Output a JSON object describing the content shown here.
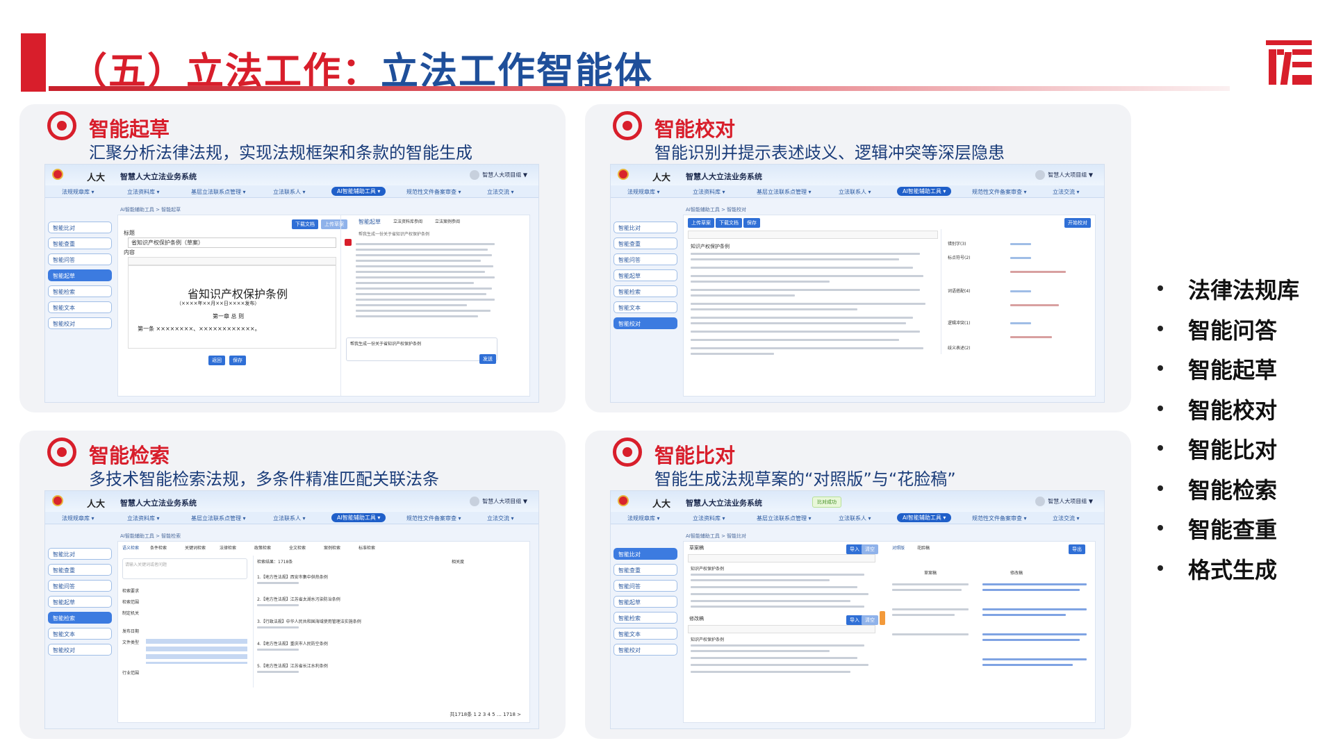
{
  "slide": {
    "title_part1": "（五）立法工作：",
    "title_part2": "立法工作智能体"
  },
  "feature_list": [
    "法律法规库",
    "智能问答",
    "智能起草",
    "智能校对",
    "智能比对",
    "智能检索",
    "智能查重",
    "格式生成"
  ],
  "panels": [
    {
      "title": "智能起草",
      "desc": "汇聚分析法律法规，实现法规框架和条款的智能生成"
    },
    {
      "title": "智能校对",
      "desc": "智能识别并提示表述歧义、逻辑冲突等深层隐患"
    },
    {
      "title": "智能检索",
      "desc": "多技术智能检索法规，多条件精准匹配关联法条"
    },
    {
      "title": "智能比对",
      "desc": "智能生成法规草案的“对照版”与“花脸稿”"
    }
  ],
  "app": {
    "brand": "人大",
    "system_name": "智慧人大立法业务系统",
    "user": "智慧人大项目组 ▼",
    "nav": [
      "法规规章库 ▾",
      "立法资料库 ▾",
      "基层立法联系点管理 ▾",
      "立法联系人 ▾",
      "AI智能辅助工具 ▾",
      "规范性文件备案审查 ▾",
      "立法交流 ▾"
    ],
    "sidebar": [
      "智能比对",
      "智能查重",
      "智能问答",
      "智能起草",
      "智能检索",
      "智能文本",
      "智能校对"
    ],
    "crumb_draft": "AI智能辅助工具  >  智能起草",
    "crumb_proof": "AI智能辅助工具  >  智能校对",
    "crumb_search": "AI智能辅助工具  >  智能检索",
    "crumb_compare": "AI智能辅助工具  >  智能比对"
  },
  "draft": {
    "btn_download": "下载文档",
    "btn_upload": "上传草案",
    "label_title": "标题",
    "title_value": "省知识产权保护条例（草案）",
    "label_content": "内容",
    "doc_heading": "省知识产权保护条例",
    "doc_sub": "（××××年××月××日××××发布）",
    "chapter": "第一章 总 则",
    "article": "第一条 ××××××××、××××××××××××。",
    "btn_back": "返回",
    "btn_save": "保存",
    "tabs": [
      "智能起草",
      "立法资料库参阅",
      "立法案例参阅"
    ],
    "chat_user": "帮我生成一份关于省知识产权保护条例",
    "chat_prompt": "帮我生成一份关于省知识产权保护条例",
    "btn_send": "发送"
  },
  "proof": {
    "btn_upload": "上传草案",
    "btn_download": "下载文档",
    "btn_save": "保存",
    "btn_start": "开始校对",
    "doc_title": "知识产权保护条例",
    "issues": [
      "错别字(3)",
      "标点符号(2)",
      "词语搭配(4)",
      "逻辑冲突(1)",
      "歧义表述(2)"
    ]
  },
  "search": {
    "tabs": [
      "语义检索",
      "条件检索",
      "关键词检索",
      "法律检索",
      "政策检索",
      "全文检索",
      "案例检索",
      "标准检索"
    ],
    "placeholder": "请输入关键词或者问题",
    "result_label": "检索结果：1718条",
    "sort": "相关度",
    "results": [
      "1.【地方性法规】西安市集中供热条例",
      "2.【地方性法规】江苏省太湖水污染防治条例",
      "3.【行政法规】中华人民共和国海域使用管理法实施条例",
      "4.【地方性法规】重庆市人民防空条例",
      "5.【地方性法规】江苏省长江水利条例"
    ],
    "filter_labels": [
      "检索要求",
      "检索范围",
      "制定机关",
      "发布日期",
      "文件类型",
      "行业范围"
    ],
    "pager": "共1718条  1  2  3  4  5 … 1718  >"
  },
  "compare": {
    "badge": "比对成功",
    "left_top": "草案稿",
    "left_bottom": "修改稿",
    "btn_import": "导入",
    "btn_clear": "清空",
    "tab1": "对照版",
    "tab2": "花脸稿",
    "col1": "草案稿",
    "col2": "修改稿",
    "doc_title": "知识产权保护条例",
    "btn_export": "导出"
  }
}
